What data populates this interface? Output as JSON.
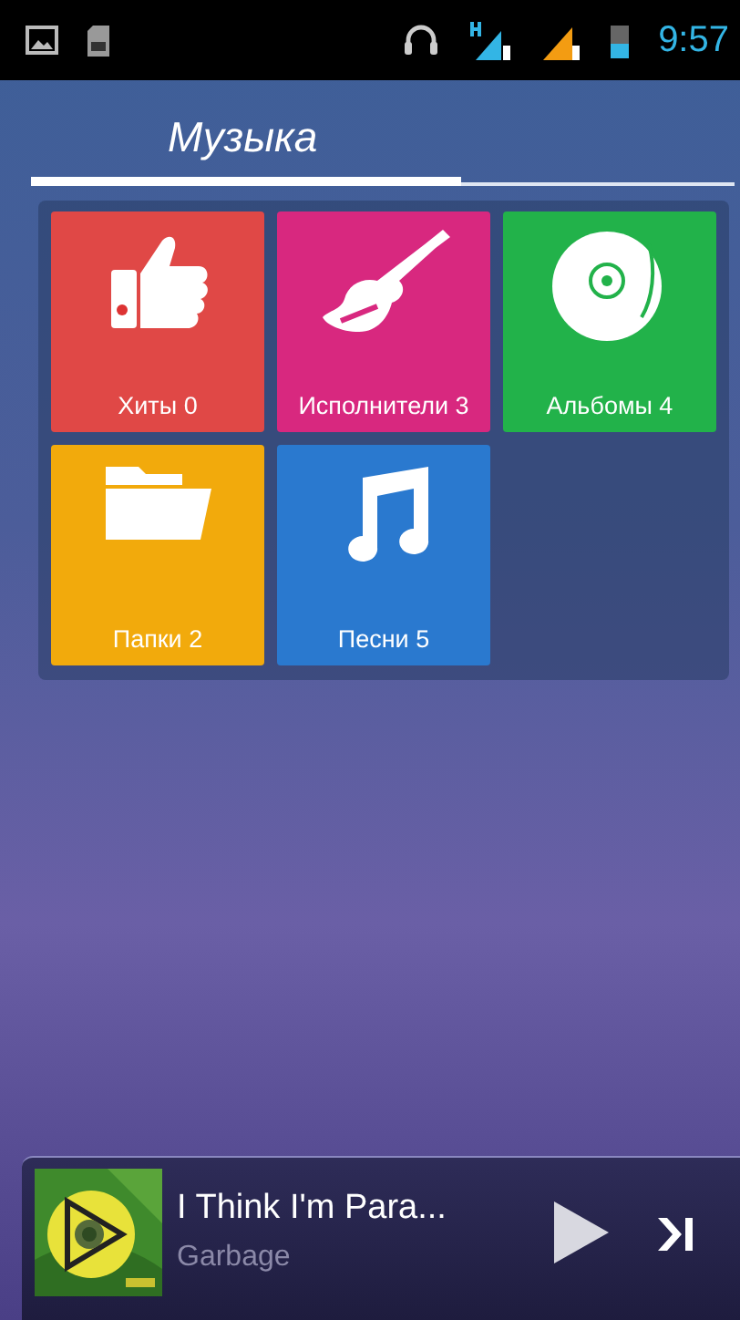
{
  "status_bar": {
    "time": "9:57"
  },
  "header": {
    "title": "Музыка"
  },
  "tiles": [
    {
      "label": "Хиты 0",
      "kind": "hits",
      "color": "#e04846"
    },
    {
      "label": "Исполнители 3",
      "kind": "artists",
      "color": "#d8287f"
    },
    {
      "label": "Альбомы 4",
      "kind": "albums",
      "color": "#22b24a"
    },
    {
      "label": "Папки 2",
      "kind": "folders",
      "color": "#f2aa0c"
    },
    {
      "label": "Песни 5",
      "kind": "songs",
      "color": "#2a79cf"
    }
  ],
  "player": {
    "title": "I Think I'm Para...",
    "artist": "Garbage"
  }
}
